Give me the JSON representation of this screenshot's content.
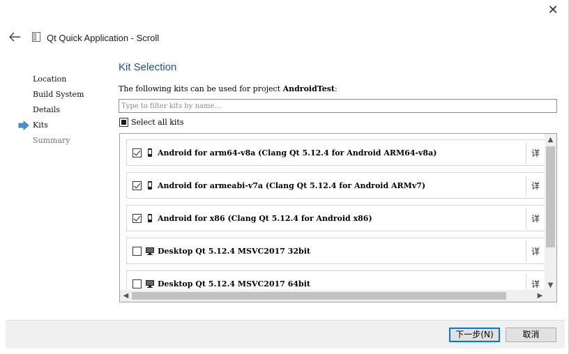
{
  "window": {
    "close_glyph": "✕"
  },
  "header": {
    "title": "Qt Quick Application - Scroll",
    "back_icon": "back-arrow-icon",
    "wizard_icon": "wizard-page-icon"
  },
  "steps": [
    {
      "label": "Location",
      "state": "done"
    },
    {
      "label": "Build System",
      "state": "done"
    },
    {
      "label": "Details",
      "state": "done"
    },
    {
      "label": "Kits",
      "state": "current"
    },
    {
      "label": "Summary",
      "state": "future"
    }
  ],
  "page": {
    "title": "Kit Selection",
    "desc_prefix": "The following kits can be used for project ",
    "project": "AndroidTest",
    "desc_suffix": ":",
    "filter_placeholder": "Type to filter kits by name...",
    "select_all_label": "Select all kits"
  },
  "kits": [
    {
      "name": "Android for arm64-v8a (Clang Qt 5.12.4 for Android ARM64-v8a)",
      "checked": true,
      "icon": "android-device-icon",
      "detail": "详"
    },
    {
      "name": "Android for armeabi-v7a (Clang Qt 5.12.4 for Android ARMv7)",
      "checked": true,
      "icon": "android-device-icon",
      "detail": "详"
    },
    {
      "name": "Android for x86 (Clang Qt 5.12.4 for Android x86)",
      "checked": true,
      "icon": "android-device-icon",
      "detail": "详"
    },
    {
      "name": "Desktop Qt 5.12.4 MSVC2017 32bit",
      "checked": false,
      "icon": "desktop-monitor-icon",
      "detail": "详"
    },
    {
      "name": "Desktop Qt 5.12.4 MSVC2017 64bit",
      "checked": false,
      "icon": "desktop-monitor-icon",
      "detail": "详"
    }
  ],
  "footer": {
    "next_label": "下一步(N)",
    "cancel_label": "取消"
  },
  "colors": {
    "title_blue": "#1f4f8f",
    "focus_blue": "#0078d7",
    "step_arrow": "#4a8fd8"
  }
}
